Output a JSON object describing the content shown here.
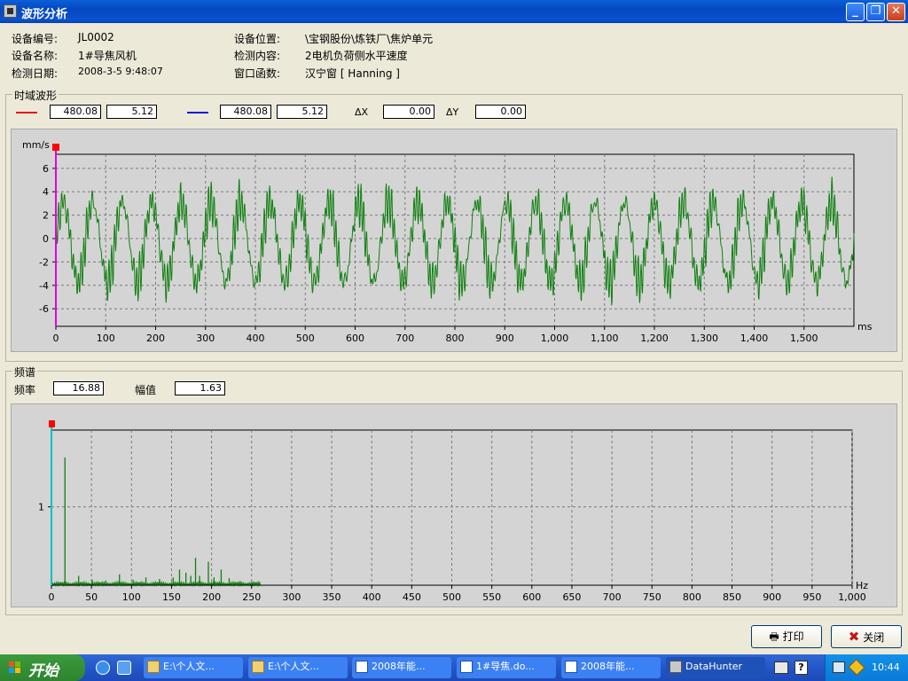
{
  "window": {
    "title": "波形分析"
  },
  "info": {
    "device_no_label": "设备编号:",
    "device_no": "JL0002",
    "device_name_label": "设备名称:",
    "device_name": "1#导焦风机",
    "date_label": "检测日期:",
    "date": "2008-3-5 9:48:07",
    "location_label": "设备位置:",
    "location": "\\宝钢股份\\炼铁厂\\焦炉单元",
    "content_label": "检测内容:",
    "content": "2电机负荷侧水平速度",
    "window_fn_label": "窗口函数:",
    "window_fn": "汉宁窗 [ Hanning ]"
  },
  "time_group": {
    "label": "时域波形",
    "cursor1": {
      "color": "#e81010",
      "x": "480.08",
      "y": "5.12"
    },
    "cursor2": {
      "color": "#1010e0",
      "x": "480.08",
      "y": "5.12"
    },
    "dx_label": "ΔX",
    "dx": "0.00",
    "dy_label": "ΔY",
    "dy": "0.00"
  },
  "freq_group": {
    "label": "频谱",
    "freq_label": "频率",
    "freq": "16.88",
    "amp_label": "幅值",
    "amp": "1.63"
  },
  "chart_data": [
    {
      "type": "line",
      "ylabel": "mm/s",
      "xlabel": "ms",
      "xlim": [
        0,
        1600
      ],
      "ylim": [
        -7.5,
        7.2
      ],
      "xticks": [
        0,
        100,
        200,
        300,
        400,
        500,
        600,
        700,
        800,
        900,
        1000,
        1100,
        1200,
        1300,
        1400,
        1500
      ],
      "xtick_labels": [
        "0",
        "100",
        "200",
        "300",
        "400",
        "500",
        "600",
        "700",
        "800",
        "900",
        "1,000",
        "1,100",
        "1,200",
        "1,300",
        "1,400",
        "1,500"
      ],
      "yticks": [
        6,
        4,
        2,
        0,
        -2,
        -4,
        -6
      ],
      "ytick_labels": [
        "6",
        "4",
        "2",
        "0",
        "-2",
        "-4",
        "-6"
      ],
      "grid": true,
      "color": "#108010",
      "signal": {
        "dominant_frequency_hz": 16.88,
        "amplitude": 3.4,
        "range": [
          -5.3,
          4.8
        ]
      },
      "cursor_x": 0
    },
    {
      "type": "line",
      "xlabel": "Hz",
      "xlim": [
        0,
        1000
      ],
      "ylim": [
        0,
        1.98
      ],
      "xticks": [
        0,
        50,
        100,
        150,
        200,
        250,
        300,
        350,
        400,
        450,
        500,
        550,
        600,
        650,
        700,
        750,
        800,
        850,
        900,
        950,
        1000
      ],
      "xtick_labels": [
        "0",
        "50",
        "100",
        "150",
        "200",
        "250",
        "300",
        "350",
        "400",
        "450",
        "500",
        "550",
        "600",
        "650",
        "700",
        "750",
        "800",
        "850",
        "900",
        "950",
        "1,000"
      ],
      "yticks": [
        1
      ],
      "ytick_labels": [
        "1"
      ],
      "grid": true,
      "color": "#108010",
      "peaks": [
        {
          "x": 16.88,
          "y": 1.63
        },
        {
          "x": 34,
          "y": 0.12
        },
        {
          "x": 51,
          "y": 0.07
        },
        {
          "x": 68,
          "y": 0.06
        },
        {
          "x": 85,
          "y": 0.14
        },
        {
          "x": 102,
          "y": 0.07
        },
        {
          "x": 118,
          "y": 0.1
        },
        {
          "x": 135,
          "y": 0.08
        },
        {
          "x": 152,
          "y": 0.1
        },
        {
          "x": 160,
          "y": 0.2
        },
        {
          "x": 168,
          "y": 0.16
        },
        {
          "x": 174,
          "y": 0.12
        },
        {
          "x": 180,
          "y": 0.35
        },
        {
          "x": 185,
          "y": 0.12
        },
        {
          "x": 196,
          "y": 0.3
        },
        {
          "x": 203,
          "y": 0.1
        },
        {
          "x": 212,
          "y": 0.2
        },
        {
          "x": 222,
          "y": 0.09
        },
        {
          "x": 236,
          "y": 0.05
        }
      ]
    }
  ],
  "buttons": {
    "print": "打印",
    "close": "关闭"
  },
  "taskbar": {
    "start": "开始",
    "items": [
      "E:\\个人文...",
      "E:\\个人文...",
      "2008年能...",
      "1#导焦.do...",
      "2008年能...",
      "DataHunter"
    ],
    "clock": "10:44"
  }
}
